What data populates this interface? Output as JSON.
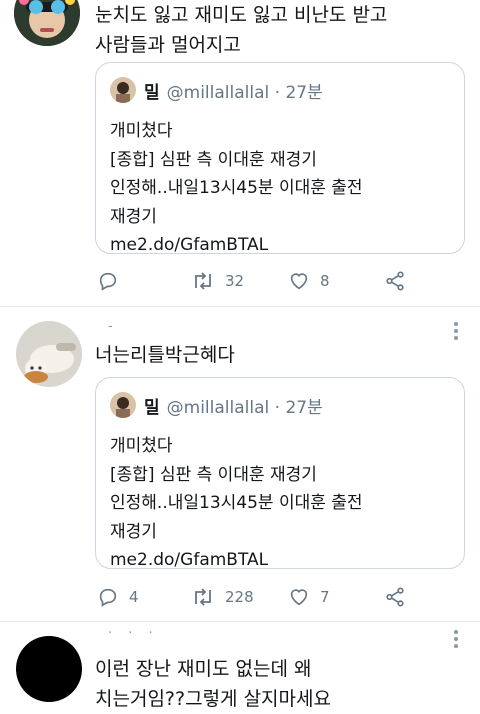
{
  "tweets": [
    {
      "text_lines": [
        "눈치도 잃고 재미도 잃고 비난도 받고",
        "사람들과 멀어지고"
      ],
      "quote": {
        "name": "밀",
        "handle": "@millallallal · 27분",
        "lines": [
          "개미쳤다",
          "[종합] 심판 측 이대훈 재경기",
          "인정해..내일13시45분 이대훈 출전",
          "재경기",
          "me2.do/GfamBTAL"
        ]
      },
      "actions": {
        "reply_count": "",
        "retweet_count": "32",
        "like_count": "8"
      }
    },
    {
      "text_lines": [
        "너는리틀박근혜다"
      ],
      "quote": {
        "name": "밀",
        "handle": "@millallallal · 27분",
        "lines": [
          "개미쳤다",
          "[종합] 심판 측 이대훈 재경기",
          "인정해..내일13시45분 이대훈 출전",
          "재경기",
          "me2.do/GfamBTAL"
        ]
      },
      "actions": {
        "reply_count": "4",
        "retweet_count": "228",
        "like_count": "7"
      }
    },
    {
      "text_lines": [
        "이런 장난 재미도 없는데 왜",
        "치는거임??그렇게 살지마세요"
      ]
    }
  ],
  "icons": {
    "reply": "reply-icon",
    "retweet": "retweet-icon",
    "like": "heart-icon",
    "share": "share-icon",
    "more": "more-options-icon"
  },
  "colors": {
    "text": "#14171a",
    "muted": "#657786",
    "border": "#ccd6dd",
    "divider": "#e1e8ed"
  }
}
